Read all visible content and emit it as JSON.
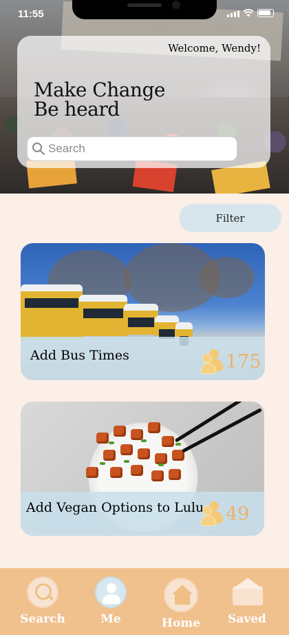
{
  "status_bar": {
    "time": "11:55"
  },
  "hero": {
    "welcome": "Welcome, Wendy!",
    "headline_line1": "Make Change",
    "headline_line2": "Be heard",
    "search_placeholder": "Search",
    "search_value": ""
  },
  "filter": {
    "label": "Filter"
  },
  "cards": [
    {
      "title": "Add Bus Times",
      "supporters": "175"
    },
    {
      "title": "Add Vegan Options to Lulu",
      "supporters": "49"
    }
  ],
  "bottom_nav": {
    "items": [
      {
        "label": "Search",
        "icon": "search-icon"
      },
      {
        "label": "Me",
        "icon": "user-icon"
      },
      {
        "label": "Home",
        "icon": "home-icon"
      },
      {
        "label": "Saved",
        "icon": "envelope-icon"
      }
    ]
  },
  "colors": {
    "background": "#fcefe7",
    "nav_bar": "#f0c08d",
    "accent_count": "#ebb26c",
    "card_band": "#c8e0ec",
    "filter_button": "#d6e6ec"
  }
}
